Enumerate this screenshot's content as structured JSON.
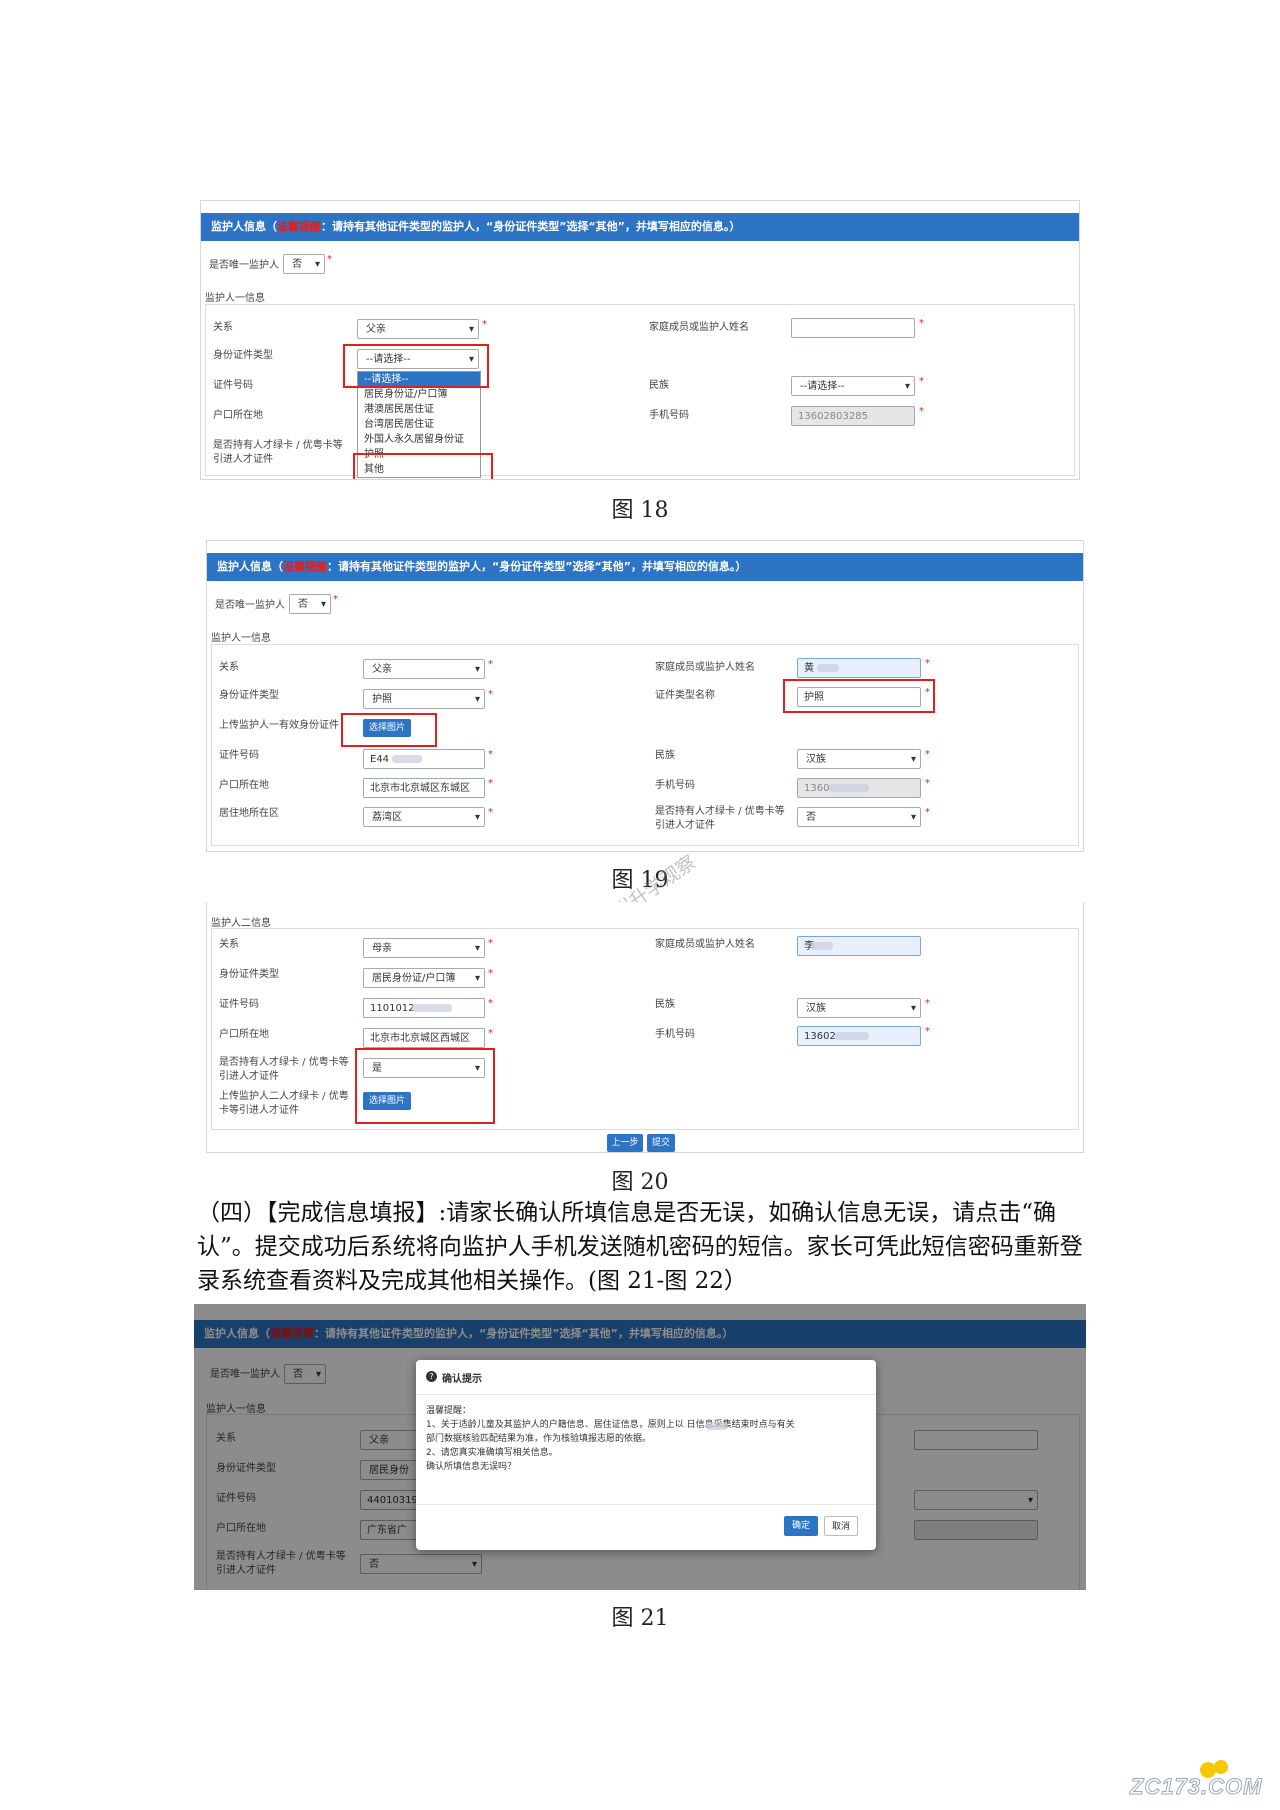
{
  "guardian_header": {
    "prefix": "监护人信息（",
    "tip": "温馨提醒",
    "text": "：请持有其他证件类型的监护人，“身份证件类型”选择“其他”，并填写相应的信息。）"
  },
  "only_guardian_label": "是否唯一监护人",
  "only_guardian_value": "否",
  "guardian1_section": "监护人一信息",
  "guardian2_section": "监护人二信息",
  "labels": {
    "relation": "关系",
    "id_type": "身份证件类型",
    "id_number": "证件号码",
    "hukou": "户口所在地",
    "talent1": "是否持有人才绿卡 / 优粤卡等",
    "talent2": "引进人才证件",
    "name": "家庭成员或监护人姓名",
    "ethnic": "民族",
    "phone": "手机号码",
    "id_type_name": "证件类型名称",
    "upload1": "上传监护人一有效身份证件",
    "residence": "居住地所在区",
    "upload2a": "上传监护人二人才绿卡 / 优粤",
    "upload2b": "卡等引进人才证件"
  },
  "fig18": {
    "relation": "父亲",
    "id_type": "--请选择--",
    "ethnic": "--请选择--",
    "phone": "13602803285",
    "dropdown": [
      "--请选择--",
      "居民身份证/户口簿",
      "港澳居民居住证",
      "台湾居民居住证",
      "外国人永久居留身份证",
      "护照",
      "其他"
    ]
  },
  "fig19": {
    "relation": "父亲",
    "id_type": "护照",
    "upload_btn": "选择图片",
    "id_number": "E44",
    "hukou": "北京市北京城区东城区",
    "residence": "荔湾区",
    "name": "黄",
    "id_type_name": "护照",
    "ethnic": "汉族",
    "phone": "1360",
    "talent": "否"
  },
  "fig20": {
    "relation": "母亲",
    "id_type": "居民身份证/户口簿",
    "id_number": "1101012",
    "hukou": "北京市北京城区西城区",
    "talent": "是",
    "upload_btn": "选择图片",
    "name": "李",
    "ethnic": "汉族",
    "phone": "13602",
    "prev_btn": "上一步",
    "submit_btn": "提交"
  },
  "watermark": "公众号：广州升学观察",
  "fig21": {
    "relation": "父亲",
    "id_type": "居民身份",
    "id_number": "44010319",
    "hukou": "广东省广",
    "talent": "否",
    "modal_title": "确认提示",
    "modal_lines": [
      "温馨提醒：",
      "1、关于适龄儿童及其监护人的户籍信息、居住证信息，原则上以    日信息采集结束时点与有关",
      "部门数据核验匹配结果为准，作为核验填报志愿的依据。",
      "2、请您真实准确填写相关信息。",
      "确认所填信息无误吗？"
    ],
    "ok_btn": "确定",
    "cancel_btn": "取消"
  },
  "captions": {
    "c18": "图 18",
    "c19": "图 19",
    "c20": "图 20",
    "c21": "图 21"
  },
  "paragraph": "（四）【完成信息填报】:请家长确认所填信息是否无误，如确认信息无误，请点击“确认”。提交成功后系统将向监护人手机发送随机密码的短信。家长可凭此短信密码重新登录系统查看资料及完成其他相关操作。(图 21-图 22）",
  "site_logo": "ZC173.COM"
}
